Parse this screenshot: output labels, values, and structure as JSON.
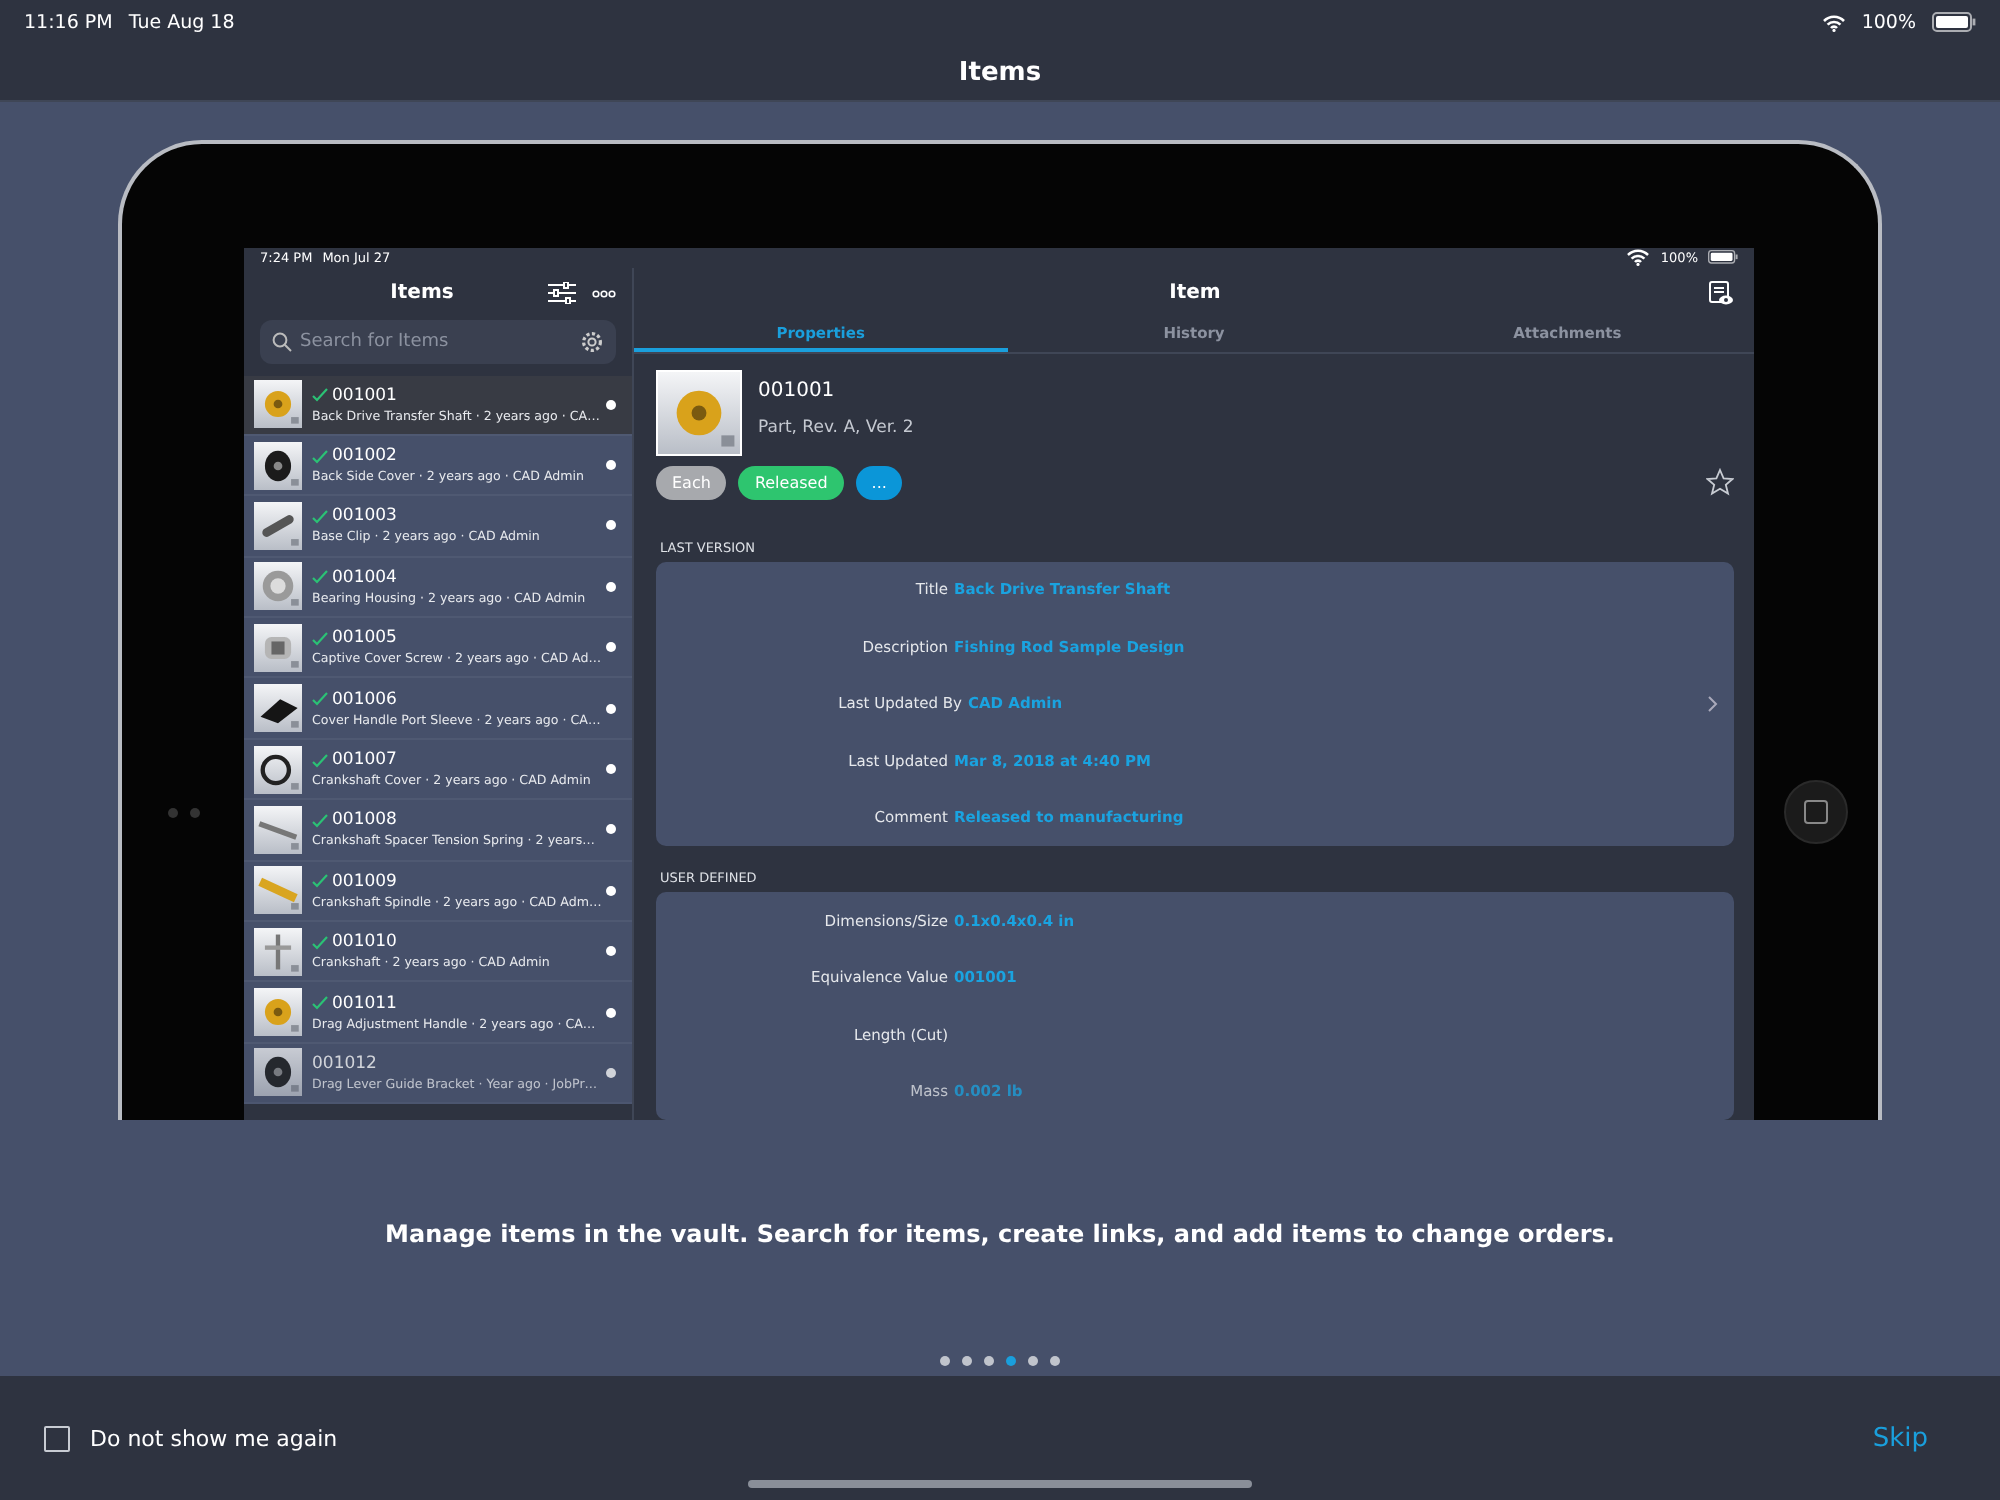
{
  "status_bar": {
    "time": "11:16 PM",
    "date": "Tue Aug 18",
    "battery": "100%"
  },
  "nav_bar": {
    "title": "Items"
  },
  "device": {
    "status_bar": {
      "time": "7:24 PM",
      "date": "Mon Jul 27",
      "battery": "100%"
    },
    "list_pane": {
      "title": "Items",
      "search": {
        "placeholder": "Search for Items"
      },
      "items": [
        {
          "number": "001001",
          "subtitle": "Back Drive Transfer Shaft · 2 years ago · CA…",
          "checked": true,
          "selected": true,
          "dimmed": false
        },
        {
          "number": "001002",
          "subtitle": "Back Side Cover · 2 years ago · CAD Admin",
          "checked": true,
          "selected": false,
          "dimmed": false
        },
        {
          "number": "001003",
          "subtitle": "Base Clip · 2 years ago · CAD Admin",
          "checked": true,
          "selected": false,
          "dimmed": false
        },
        {
          "number": "001004",
          "subtitle": "Bearing Housing · 2 years ago · CAD Admin",
          "checked": true,
          "selected": false,
          "dimmed": false
        },
        {
          "number": "001005",
          "subtitle": "Captive Cover Screw · 2 years ago · CAD Ad…",
          "checked": true,
          "selected": false,
          "dimmed": false
        },
        {
          "number": "001006",
          "subtitle": "Cover Handle Port Sleeve · 2 years ago · CA…",
          "checked": true,
          "selected": false,
          "dimmed": false
        },
        {
          "number": "001007",
          "subtitle": "Crankshaft Cover · 2 years ago · CAD Admin",
          "checked": true,
          "selected": false,
          "dimmed": false
        },
        {
          "number": "001008",
          "subtitle": "Crankshaft Spacer Tension Spring · 2 years…",
          "checked": true,
          "selected": false,
          "dimmed": false
        },
        {
          "number": "001009",
          "subtitle": "Crankshaft Spindle · 2 years ago · CAD Adm…",
          "checked": true,
          "selected": false,
          "dimmed": false
        },
        {
          "number": "001010",
          "subtitle": "Crankshaft · 2 years ago · CAD Admin",
          "checked": true,
          "selected": false,
          "dimmed": false
        },
        {
          "number": "001011",
          "subtitle": "Drag Adjustment Handle · 2 years ago · CA…",
          "checked": true,
          "selected": false,
          "dimmed": false
        },
        {
          "number": "001012",
          "subtitle": "Drag Lever Guide Bracket · Year ago · JobPr…",
          "checked": false,
          "selected": false,
          "dimmed": true
        }
      ]
    },
    "detail_pane": {
      "title": "Item",
      "tabs": [
        {
          "label": "Properties",
          "selected": true
        },
        {
          "label": "History",
          "selected": false
        },
        {
          "label": "Attachments",
          "selected": false
        }
      ],
      "item": {
        "number": "001001",
        "summary": "Part, Rev. A, Ver. 2",
        "chips": [
          {
            "label": "Each",
            "color": "#a7a9ad"
          },
          {
            "label": "Released",
            "color": "#2ec56f"
          },
          {
            "label": "...",
            "color": "#0b96d8"
          }
        ],
        "favorite": false
      },
      "sections": [
        {
          "heading": "LAST VERSION",
          "has_chevron": true,
          "rows": [
            {
              "label": "Title",
              "value": "Back Drive Transfer Shaft",
              "dimmed": false
            },
            {
              "label": "Description",
              "value": "Fishing Rod Sample Design",
              "dimmed": false
            },
            {
              "label": "Last Updated By",
              "value": "CAD Admin",
              "dimmed": false
            },
            {
              "label": "Last Updated",
              "value": "Mar 8, 2018 at 4:40 PM",
              "dimmed": false
            },
            {
              "label": "Comment",
              "value": "Released to manufacturing",
              "dimmed": false
            }
          ]
        },
        {
          "heading": "USER DEFINED",
          "has_chevron": false,
          "rows": [
            {
              "label": "Dimensions/Size",
              "value": "0.1x0.4x0.4 in",
              "dimmed": false
            },
            {
              "label": "Equivalence Value",
              "value": "001001",
              "dimmed": false
            },
            {
              "label": "Length (Cut)",
              "dimmed": false
            },
            {
              "label": "Mass",
              "value": "0.002 lb",
              "dimmed": true
            }
          ]
        }
      ]
    }
  },
  "caption": "Manage items in the vault. Search for items, create links, and add items to change orders.",
  "pages": [
    {
      "selected": false
    },
    {
      "selected": false
    },
    {
      "selected": false
    },
    {
      "selected": true
    },
    {
      "selected": false
    },
    {
      "selected": false
    }
  ],
  "footer": {
    "checkbox": {
      "label": "Do not show me again",
      "checked": false
    },
    "skip": "Skip"
  }
}
